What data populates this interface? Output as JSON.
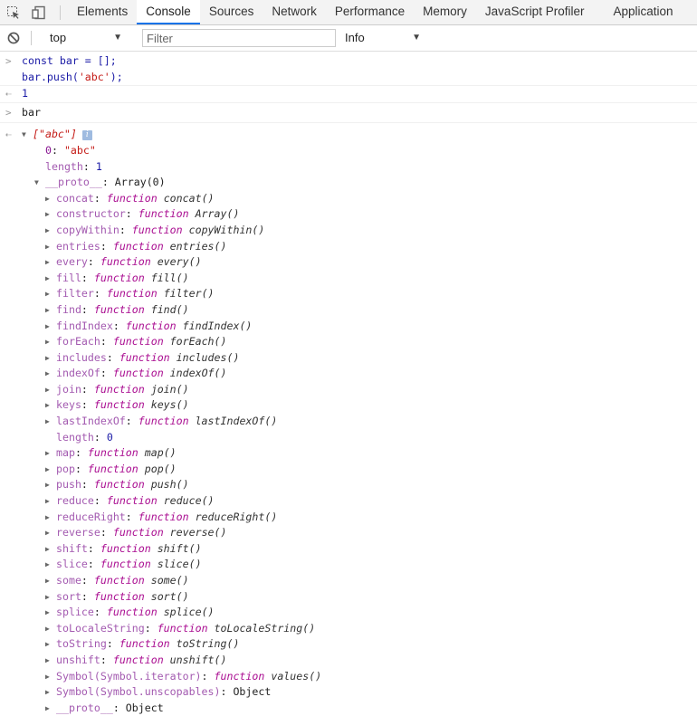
{
  "tabs": [
    "Elements",
    "Console",
    "Sources",
    "Network",
    "Performance",
    "Memory",
    "JavaScript Profiler",
    "Application"
  ],
  "toolbar": {
    "context": "top",
    "filter_placeholder": "Filter",
    "level": "Info"
  },
  "console": {
    "input1_line1": "const bar = [];",
    "input1_line2_pre": "bar.push(",
    "input1_line2_str": "'abc'",
    "input1_line2_post": ");",
    "result1": "1",
    "input2": "bar",
    "array_preview": "[\"abc\"]",
    "item0_key": "0",
    "item0_value": "\"abc\"",
    "length_key": "length",
    "length_value": "1",
    "proto_key": "__proto__",
    "proto_value": "Array(0)",
    "proto_length_key": "length",
    "proto_length_value": "0",
    "last_row_key": "__proto__",
    "last_row_value": "Object"
  },
  "methods_a": [
    {
      "key": "concat",
      "name": "concat()"
    },
    {
      "key": "constructor",
      "name": "Array()"
    },
    {
      "key": "copyWithin",
      "name": "copyWithin()"
    },
    {
      "key": "entries",
      "name": "entries()"
    },
    {
      "key": "every",
      "name": "every()"
    },
    {
      "key": "fill",
      "name": "fill()"
    },
    {
      "key": "filter",
      "name": "filter()"
    },
    {
      "key": "find",
      "name": "find()"
    },
    {
      "key": "findIndex",
      "name": "findIndex()"
    },
    {
      "key": "forEach",
      "name": "forEach()"
    },
    {
      "key": "includes",
      "name": "includes()"
    },
    {
      "key": "indexOf",
      "name": "indexOf()"
    },
    {
      "key": "join",
      "name": "join()"
    },
    {
      "key": "keys",
      "name": "keys()"
    },
    {
      "key": "lastIndexOf",
      "name": "lastIndexOf()"
    }
  ],
  "methods_b": [
    {
      "key": "map",
      "name": "map()"
    },
    {
      "key": "pop",
      "name": "pop()"
    },
    {
      "key": "push",
      "name": "push()"
    },
    {
      "key": "reduce",
      "name": "reduce()"
    },
    {
      "key": "reduceRight",
      "name": "reduceRight()"
    },
    {
      "key": "reverse",
      "name": "reverse()"
    },
    {
      "key": "shift",
      "name": "shift()"
    },
    {
      "key": "slice",
      "name": "slice()"
    },
    {
      "key": "some",
      "name": "some()"
    },
    {
      "key": "sort",
      "name": "sort()"
    },
    {
      "key": "splice",
      "name": "splice()"
    },
    {
      "key": "toLocaleString",
      "name": "toLocaleString()"
    },
    {
      "key": "toString",
      "name": "toString()"
    },
    {
      "key": "unshift",
      "name": "unshift()"
    },
    {
      "key": "Symbol(Symbol.iterator)",
      "name": "values()"
    }
  ],
  "unscopables": {
    "key": "Symbol(Symbol.unscopables)",
    "value": "Object"
  },
  "function_keyword": "function"
}
